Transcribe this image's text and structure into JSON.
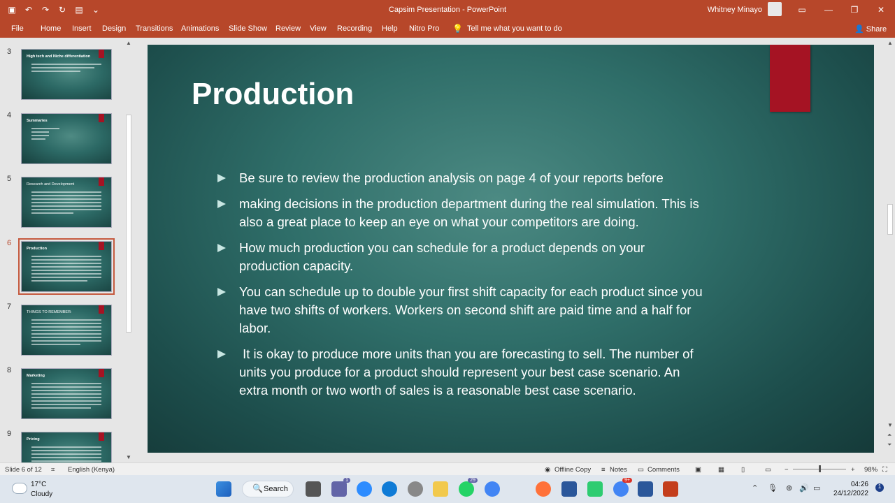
{
  "titlebar": {
    "title": "Capsim Presentation  -  PowerPoint",
    "user": "Whitney Minayo"
  },
  "ribbon": {
    "tabs": [
      "File",
      "Home",
      "Insert",
      "Design",
      "Transitions",
      "Animations",
      "Slide Show",
      "Review",
      "View",
      "Recording",
      "Help",
      "Nitro Pro"
    ],
    "tell": "Tell me what you want to do",
    "share": "Share"
  },
  "thumbnails": [
    {
      "num": "3",
      "title": "High tech and Niche differentiation"
    },
    {
      "num": "4",
      "title": "Summaries"
    },
    {
      "num": "5",
      "title": "Research and Development"
    },
    {
      "num": "6",
      "title": "Production"
    },
    {
      "num": "7",
      "title": "THINGS TO REMEMBER:"
    },
    {
      "num": "8",
      "title": "Marketing"
    },
    {
      "num": "9",
      "title": "Pricing"
    }
  ],
  "slide": {
    "title": "Production",
    "bullets": [
      {
        "line1": "Be sure to review the production analysis on page 4 of your reports before",
        "line2": ""
      },
      {
        "line1": "making decisions in the production department during the real simulation. This is",
        "line2": "also a great place to keep an eye on what your competitors are doing."
      },
      {
        "line1": "How much production you can schedule for a product depends on your",
        "line2": "production capacity."
      },
      {
        "line1": "You can schedule up to double your first shift capacity for each product since you",
        "line2": "have two shifts of workers. Workers on second shift are paid time and a half for",
        "line3": "labor."
      },
      {
        "line1": " It is okay to produce more units than you are forecasting to sell. The number of",
        "line2": "units you produce for a product should represent your best case scenario. An",
        "line3": "extra month or two worth of sales is a reasonable best case scenario."
      }
    ]
  },
  "status": {
    "slide": "Slide 6 of 12",
    "language": "English (Kenya)",
    "offline": "Offline Copy",
    "notes": "Notes",
    "comments": "Comments",
    "zoom": "98%"
  },
  "taskbar": {
    "temp": "17°C",
    "weather": "Cloudy",
    "search": "Search",
    "time": "04:26",
    "date": "24/12/2022",
    "teams_badge": "1",
    "whatsapp_badge": "29",
    "chrome_badge": "9+"
  }
}
